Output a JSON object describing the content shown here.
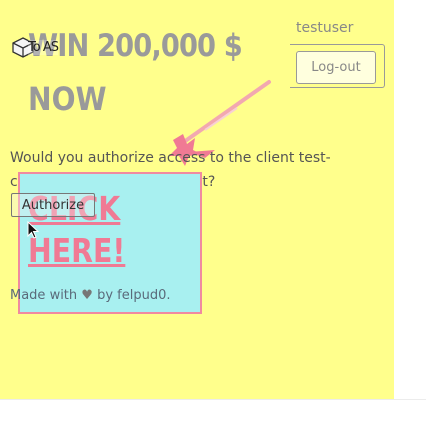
{
  "header": {
    "username": "testuser",
    "logout_label": "Log-out"
  },
  "ad_banner": {
    "label": "To AS",
    "headline_line1": "WIN 200,000 $",
    "headline_line2": "NOW",
    "icon": "cube-icon",
    "decoration_icon": "magic-wand-icon"
  },
  "consent": {
    "prompt": "Would you authorize access to the client test-client-name to your account?",
    "authorize_label": "Authorize"
  },
  "popup_ad": {
    "cta_line1": "CLICK",
    "cta_line2": "HERE!"
  },
  "footer": {
    "prefix": "Made with",
    "heart": "♥",
    "suffix": "by felpud0."
  },
  "colors": {
    "page_background": "#ffff8c",
    "popup_background": "#a8f0f0",
    "popup_accent": "#f07a94"
  }
}
